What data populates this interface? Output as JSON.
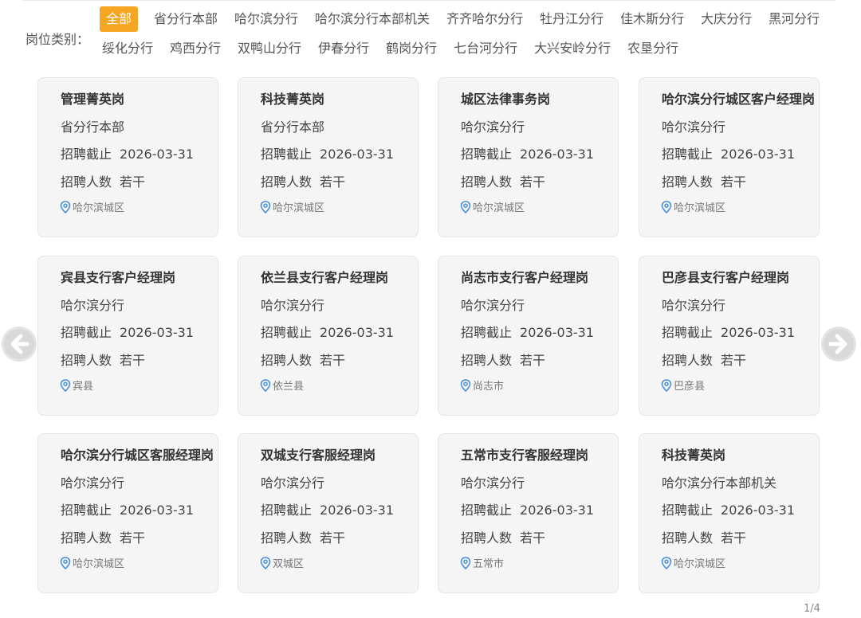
{
  "filter": {
    "label": "岗位类别：",
    "row1": [
      "全部",
      "省分行本部",
      "哈尔滨分行",
      "哈尔滨分行本部机关",
      "齐齐哈尔分行",
      "牡丹江分行",
      "佳木斯分行",
      "大庆分行",
      "黑河分行"
    ],
    "row2": [
      "绥化分行",
      "鸡西分行",
      "双鸭山分行",
      "伊春分行",
      "鹤岗分行",
      "七台河分行",
      "大兴安岭分行",
      "农垦分行"
    ],
    "active": "全部",
    "accent_color": "#f5a623"
  },
  "cards": [
    {
      "title": "管理菁英岗",
      "dept": "省分行本部",
      "deadline_label": "招聘截止",
      "deadline": "2026-03-31",
      "count_label": "招聘人数",
      "count": "若干",
      "location": "哈尔滨城区"
    },
    {
      "title": "科技菁英岗",
      "dept": "省分行本部",
      "deadline_label": "招聘截止",
      "deadline": "2026-03-31",
      "count_label": "招聘人数",
      "count": "若干",
      "location": "哈尔滨城区"
    },
    {
      "title": "城区法律事务岗",
      "dept": "哈尔滨分行",
      "deadline_label": "招聘截止",
      "deadline": "2026-03-31",
      "count_label": "招聘人数",
      "count": "若干",
      "location": "哈尔滨城区"
    },
    {
      "title": "哈尔滨分行城区客户经理岗",
      "dept": "哈尔滨分行",
      "deadline_label": "招聘截止",
      "deadline": "2026-03-31",
      "count_label": "招聘人数",
      "count": "若干",
      "location": "哈尔滨城区"
    },
    {
      "title": "宾县支行客户经理岗",
      "dept": "哈尔滨分行",
      "deadline_label": "招聘截止",
      "deadline": "2026-03-31",
      "count_label": "招聘人数",
      "count": "若干",
      "location": "宾县"
    },
    {
      "title": "依兰县支行客户经理岗",
      "dept": "哈尔滨分行",
      "deadline_label": "招聘截止",
      "deadline": "2026-03-31",
      "count_label": "招聘人数",
      "count": "若干",
      "location": "依兰县"
    },
    {
      "title": "尚志市支行客户经理岗",
      "dept": "哈尔滨分行",
      "deadline_label": "招聘截止",
      "deadline": "2026-03-31",
      "count_label": "招聘人数",
      "count": "若干",
      "location": "尚志市"
    },
    {
      "title": "巴彦县支行客户经理岗",
      "dept": "哈尔滨分行",
      "deadline_label": "招聘截止",
      "deadline": "2026-03-31",
      "count_label": "招聘人数",
      "count": "若干",
      "location": "巴彦县"
    },
    {
      "title": "哈尔滨分行城区客服经理岗",
      "dept": "哈尔滨分行",
      "deadline_label": "招聘截止",
      "deadline": "2026-03-31",
      "count_label": "招聘人数",
      "count": "若干",
      "location": "哈尔滨城区"
    },
    {
      "title": "双城支行客服经理岗",
      "dept": "哈尔滨分行",
      "deadline_label": "招聘截止",
      "deadline": "2026-03-31",
      "count_label": "招聘人数",
      "count": "若干",
      "location": "双城区"
    },
    {
      "title": "五常市支行客服经理岗",
      "dept": "哈尔滨分行",
      "deadline_label": "招聘截止",
      "deadline": "2026-03-31",
      "count_label": "招聘人数",
      "count": "若干",
      "location": "五常市"
    },
    {
      "title": "科技菁英岗",
      "dept": "哈尔滨分行本部机关",
      "deadline_label": "招聘截止",
      "deadline": "2026-03-31",
      "count_label": "招聘人数",
      "count": "若干",
      "location": "哈尔滨城区"
    }
  ],
  "pager": {
    "text": "1/4"
  },
  "icons": {
    "prev": "arrow-left-icon",
    "next": "arrow-right-icon",
    "location": "map-pin-icon"
  },
  "colors": {
    "pin": "#4a90d9",
    "card_bg": "#f5f5f5"
  }
}
